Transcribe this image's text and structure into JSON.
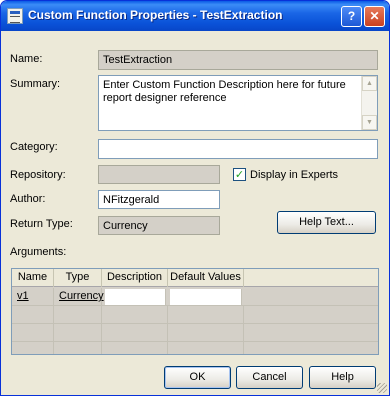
{
  "window": {
    "title": "Custom Function Properties - TestExtraction",
    "help_glyph": "?",
    "close_glyph": "✕"
  },
  "form": {
    "name_label": "Name:",
    "name_value": "TestExtraction",
    "summary_label": "Summary:",
    "summary_value": "Enter Custom Function Description here for future report designer reference",
    "category_label": "Category:",
    "category_value": "",
    "repository_label": "Repository:",
    "repository_value": "",
    "display_in_experts_label": "Display in Experts",
    "display_in_experts_checked": true,
    "author_label": "Author:",
    "author_value": "NFitzgerald",
    "return_type_label": "Return Type:",
    "return_type_value": "Currency",
    "help_text_button": "Help Text...",
    "arguments_label": "Arguments:"
  },
  "arguments_table": {
    "columns": [
      "Name",
      "Type",
      "Description",
      "Default Values"
    ],
    "rows": [
      {
        "name": "v1",
        "type": "Currency",
        "description": "",
        "default_value": ""
      }
    ]
  },
  "buttons": {
    "ok": "OK",
    "cancel": "Cancel",
    "help": "Help"
  },
  "colors": {
    "titlebar": "#0a52d8",
    "dialog_bg": "#ece9d8",
    "readonly_bg": "#d4d0c8",
    "check_mark": "#21a121"
  }
}
